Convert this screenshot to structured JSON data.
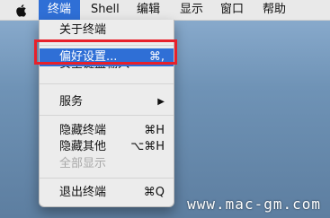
{
  "menubar": {
    "items": [
      {
        "label": "终端",
        "active": true
      },
      {
        "label": "Shell",
        "active": false
      },
      {
        "label": "编辑",
        "active": false
      },
      {
        "label": "显示",
        "active": false
      },
      {
        "label": "窗口",
        "active": false
      },
      {
        "label": "帮助",
        "active": false
      }
    ],
    "apple_icon": "apple-icon"
  },
  "terminal_menu": {
    "about": "关于终端",
    "preferences": {
      "label": "偏好设置...",
      "shortcut": "⌘,"
    },
    "secure_keyboard": "安全键盘输入",
    "services": {
      "label": "服务",
      "submenu_indicator": "▶"
    },
    "hide_terminal": {
      "label": "隐藏终端",
      "shortcut": "⌘H"
    },
    "hide_others": {
      "label": "隐藏其他",
      "shortcut": "⌥⌘H"
    },
    "show_all": "全部显示",
    "quit": {
      "label": "退出终端",
      "shortcut": "⌘Q"
    }
  },
  "watermark": "www.mac-gm.com",
  "colors": {
    "highlight": "#2f6fd6",
    "annotation_box": "#e8202a"
  }
}
